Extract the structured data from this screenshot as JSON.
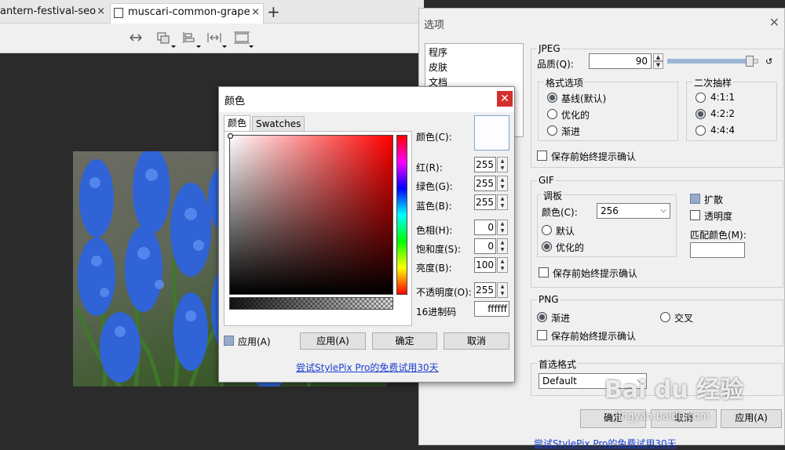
{
  "tabs": [
    {
      "label": "antern-festival-seo"
    },
    {
      "label": "muscari-common-grape"
    }
  ],
  "tab_close": "×",
  "new_tab": "+",
  "options": {
    "title": "选项",
    "close": "✕",
    "categories": [
      "程序",
      "皮肤",
      "文档"
    ],
    "jpeg": {
      "group": "JPEG",
      "quality_label": "品质(Q):",
      "quality_value": "90",
      "quality_slider": 0.95,
      "format_group": "格式选项",
      "format_options": [
        "基线(默认)",
        "优化的",
        "渐进"
      ],
      "format_selected": 0,
      "subsample_group": "二次抽样",
      "subsample_options": [
        "4:1:1",
        "4:2:2",
        "4:4:4"
      ],
      "subsample_selected": 1,
      "confirm": "保存前始终提示确认"
    },
    "gif": {
      "group": "GIF",
      "palette_group": "调板",
      "colors_label": "颜色(C):",
      "colors_value": "256",
      "palette_options": [
        "默认",
        "优化的"
      ],
      "palette_selected": 1,
      "diffuse": "扩散",
      "transparency": "透明度",
      "match_color": "匹配颜色(M):",
      "confirm": "保存前始终提示确认"
    },
    "png": {
      "group": "PNG",
      "options": [
        "渐进",
        "交叉"
      ],
      "selected": 0,
      "confirm": "保存前始终提示确认"
    },
    "preferred_group": "首选格式",
    "preferred_value": "Default",
    "buttons": {
      "ok": "确定",
      "cancel": "取消",
      "apply": "应用(A)"
    },
    "trial_link": "尝试StylePix Pro的免费试用30天"
  },
  "color_dialog": {
    "title": "颜色",
    "close": "✕",
    "tabs": [
      "颜色",
      "Swatches"
    ],
    "color_label": "颜色(C):",
    "preview_color": "#fdfdff",
    "fields": {
      "red": {
        "label": "红(R):",
        "value": "255"
      },
      "green": {
        "label": "绿色(G):",
        "value": "255"
      },
      "blue": {
        "label": "蓝色(B):",
        "value": "255"
      },
      "hue": {
        "label": "色相(H):",
        "value": "0"
      },
      "saturation": {
        "label": "饱和度(S):",
        "value": "0"
      },
      "brightness": {
        "label": "亮度(B):",
        "value": "100"
      },
      "opacity": {
        "label": "不透明度(O):",
        "value": "255"
      },
      "hex": {
        "label": "16进制码",
        "value": "ffffff"
      }
    },
    "apply_checkbox": "应用(A)",
    "buttons": {
      "apply": "应用(A)",
      "ok": "确定",
      "cancel": "取消"
    },
    "trial_link": "尝试StylePix Pro的免费试用30天"
  },
  "watermark": {
    "text": "Bai du 经验",
    "url": "jingyan.baidu.com"
  }
}
